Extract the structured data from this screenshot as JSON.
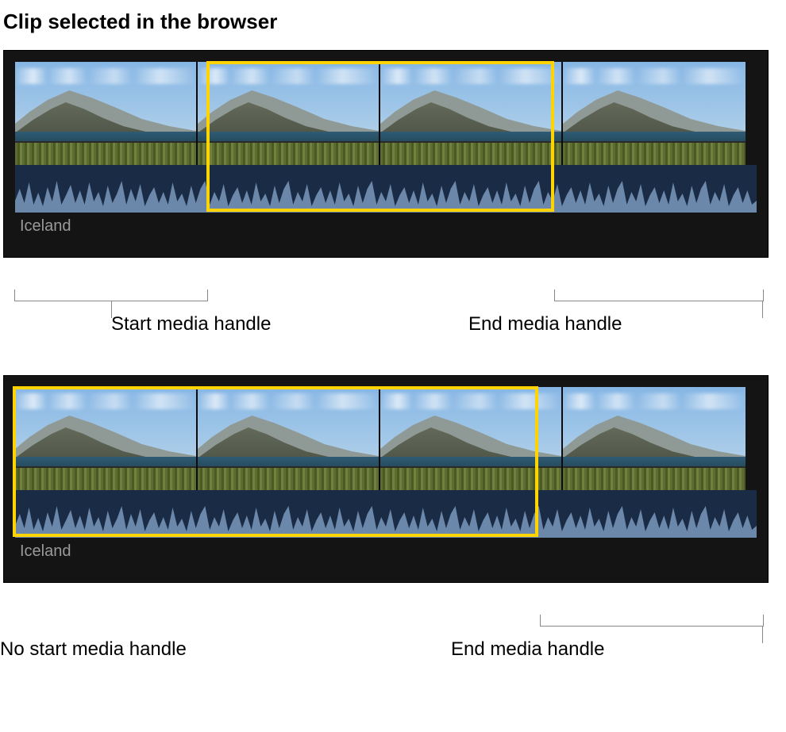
{
  "title": "Clip selected in the browser",
  "figures": [
    {
      "clip_label": "Iceland",
      "callouts": {
        "start": "Start media handle",
        "end": "End media handle"
      }
    },
    {
      "clip_label": "Iceland",
      "callouts": {
        "start": "No start media handle",
        "end": "End media handle"
      }
    }
  ]
}
